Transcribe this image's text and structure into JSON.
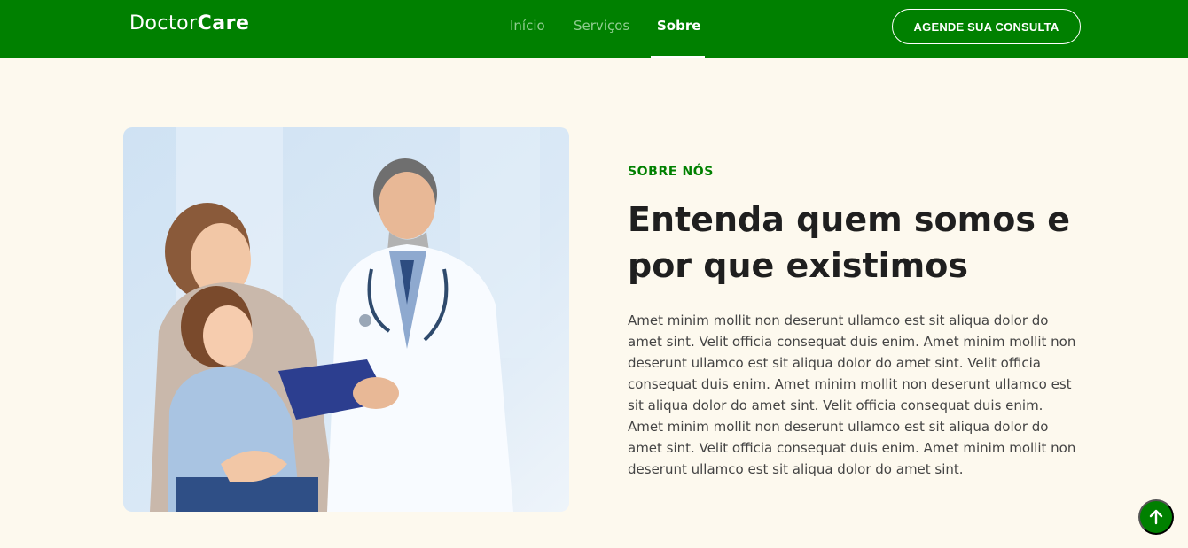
{
  "header": {
    "logo_regular": "Doctor",
    "logo_bold": "Care",
    "nav": [
      {
        "label": "Início"
      },
      {
        "label": "Serviços"
      },
      {
        "label": "Sobre"
      }
    ],
    "cta_label": "AGENDE SUA CONSULTA"
  },
  "about": {
    "eyebrow": "SOBRE NÓS",
    "headline_line1": "Entenda quem somos e",
    "headline_line2": "por que existimos",
    "body": "Amet minim mollit non deserunt ullamco est sit aliqua dolor do amet sint. Velit officia consequat duis enim. Amet minim mollit non deserunt ullamco est sit aliqua dolor do amet sint. Velit officia consequat duis enim. Amet minim mollit non deserunt ullamco est sit aliqua dolor do amet sint. Velit officia consequat duis enim. Amet minim mollit non deserunt ullamco est sit aliqua dolor do amet sint. Velit officia consequat duis enim. Amet minim mollit non deserunt ullamco est sit aliqua dolor do amet sint.",
    "image_icon": "doctor-with-patients-photo"
  },
  "scroll_top_icon": "arrow-up-icon",
  "colors": {
    "brand_green": "#008000",
    "page_background": "#fdf9ee",
    "heading": "#1f1f1f",
    "body_text": "#444444",
    "nav_inactive": "#8fcc8f"
  }
}
